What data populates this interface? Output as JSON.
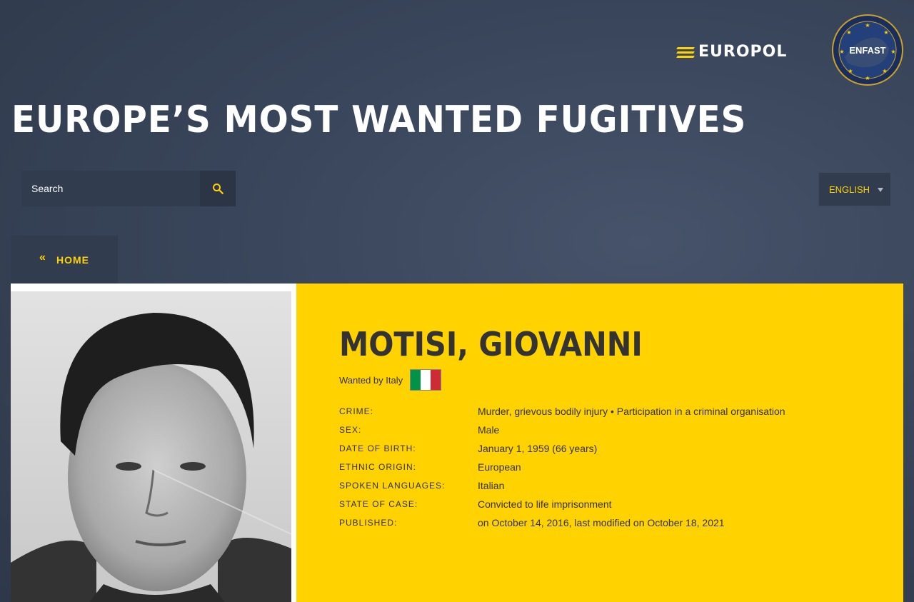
{
  "header": {
    "europol_logo_text": "EUROPOL",
    "enfast_logo_text": "ENFAST",
    "title": "EUROPE’S MOST WANTED FUGITIVES"
  },
  "search": {
    "placeholder": "Search",
    "icon": "search-icon"
  },
  "language": {
    "selected": "ENGLISH"
  },
  "nav": {
    "home_chevron": "«",
    "home_label": "HOME"
  },
  "fugitive": {
    "name": "MOTISI, GIOVANNI",
    "wanted_by": "Wanted by Italy",
    "details": [
      {
        "label": "CRIME:",
        "value": "Murder, grievous bodily injury • Participation in a criminal organisation"
      },
      {
        "label": "SEX:",
        "value": "Male"
      },
      {
        "label": "DATE OF BIRTH:",
        "value": "January 1, 1959 (66 years)"
      },
      {
        "label": "ETHNIC ORIGIN:",
        "value": "European"
      },
      {
        "label": "SPOKEN LANGUAGES:",
        "value": "Italian"
      },
      {
        "label": "STATE OF CASE:",
        "value": "Convicted to life imprisonment"
      },
      {
        "label": "PUBLISHED:",
        "value": "on October 14, 2016, last modified on October 18, 2021"
      }
    ]
  },
  "colors": {
    "accent": "#ffd200",
    "background": "#39455a",
    "text_dark": "#333333"
  }
}
